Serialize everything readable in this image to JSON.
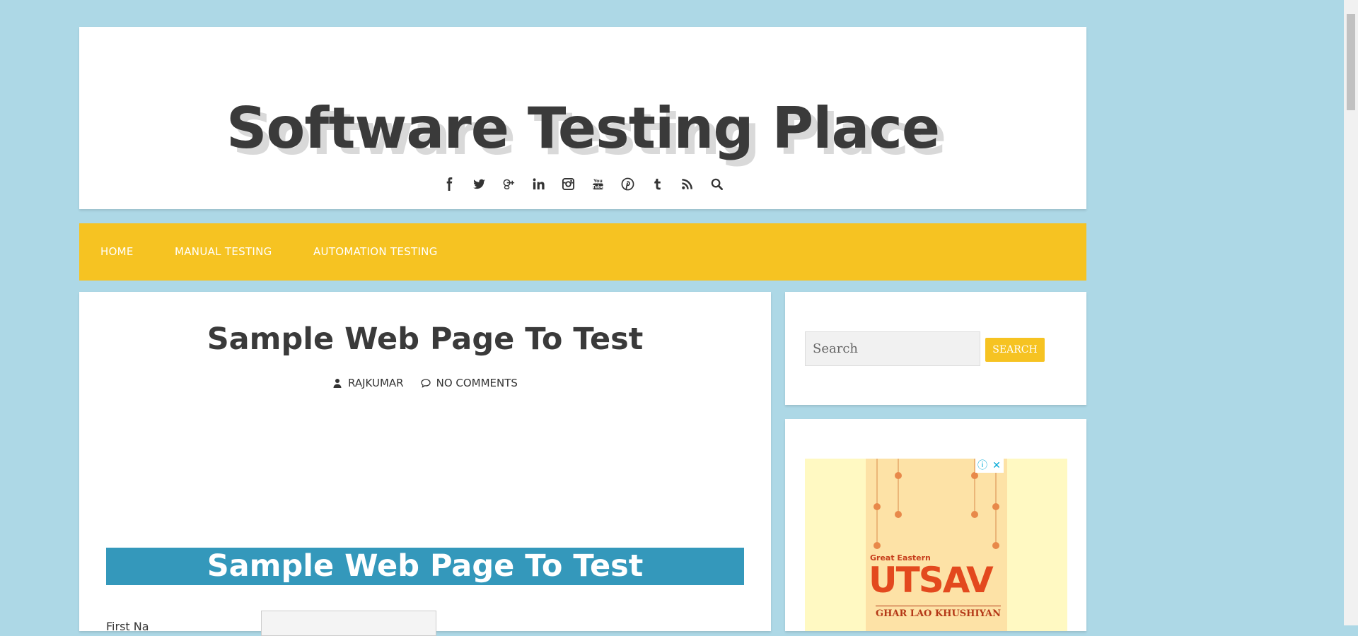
{
  "site": {
    "title": "Software Testing Place"
  },
  "social_icons": [
    "facebook-icon",
    "twitter-icon",
    "google-plus-icon",
    "linkedin-icon",
    "instagram-icon",
    "youtube-icon",
    "pinterest-icon",
    "tumblr-icon",
    "rss-icon",
    "search-icon"
  ],
  "nav": {
    "items": [
      "HOME",
      "MANUAL TESTING",
      "AUTOMATION TESTING"
    ]
  },
  "post": {
    "title": "Sample Web Page To Test",
    "author": "RAJKUMAR",
    "comments": "NO COMMENTS",
    "banner": "Sample Web Page To Test",
    "form_first_label": "First Na"
  },
  "sidebar": {
    "search_placeholder": "Search",
    "search_button": "SEARCH"
  },
  "ad": {
    "brand": "Great Eastern",
    "headline": "UTSAV",
    "tagline": "GHAR LAO KHUSHIYAN",
    "info": "ⓘ",
    "close": "✕"
  },
  "colors": {
    "background": "#add8e6",
    "accent": "#f6c322",
    "banner": "#3498bb"
  }
}
